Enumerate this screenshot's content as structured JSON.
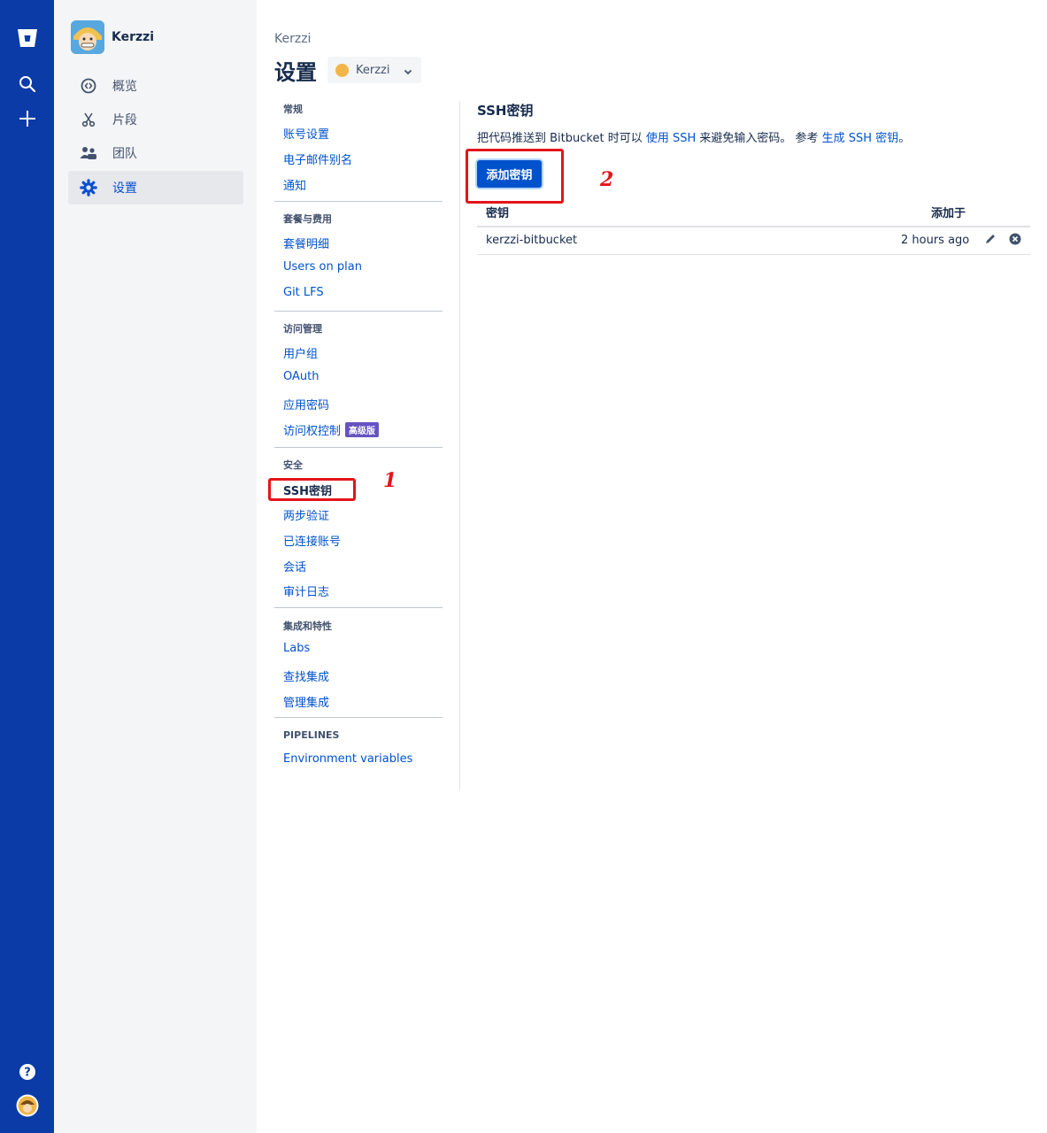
{
  "user": {
    "name": "Kerzzi"
  },
  "sidebar": {
    "items": [
      {
        "label": "概览"
      },
      {
        "label": "片段"
      },
      {
        "label": "团队"
      },
      {
        "label": "设置"
      }
    ]
  },
  "header": {
    "breadcrumb": "Kerzzi",
    "title": "设置",
    "workspace": "Kerzzi"
  },
  "settings_nav": {
    "groups": [
      {
        "heading": "常规",
        "links": [
          "账号设置",
          "电子邮件别名",
          "通知"
        ]
      },
      {
        "heading": "套餐与费用",
        "links": [
          "套餐明细",
          "Users on plan",
          "Git LFS"
        ]
      },
      {
        "heading": "访问管理",
        "links": [
          "用户组",
          "OAuth",
          "应用密码",
          "访问权控制"
        ],
        "badge": "高级版"
      },
      {
        "heading": "安全",
        "links": [
          "SSH密钥",
          "两步验证",
          "已连接账号",
          "会话",
          "审计日志"
        ]
      },
      {
        "heading": "集成和特性",
        "links": [
          "Labs",
          "查找集成",
          "管理集成"
        ]
      },
      {
        "heading": "PIPELINES",
        "links": [
          "Environment variables"
        ]
      }
    ]
  },
  "content": {
    "title": "SSH密钥",
    "desc_1": "把代码推送到 Bitbucket 时可以 ",
    "desc_link_1": "使用 SSH",
    "desc_2": " 来避免输入密码。 参考 ",
    "desc_link_2": "生成 SSH 密钥",
    "desc_3": "。",
    "add_button": "添加密钥",
    "table": {
      "headers": [
        "密钥",
        "添加于"
      ],
      "rows": [
        {
          "key": "kerzzi-bitbucket",
          "added": "2 hours ago"
        }
      ]
    }
  },
  "annotations": [
    "1",
    "2"
  ],
  "colors": {
    "rail": "#0b3ba6",
    "link": "#0052cc",
    "primary": "#0052cc",
    "annotation": "#e3151a",
    "badge": "#6554c0"
  },
  "icons": [
    "bitbucket-logo-icon",
    "search-icon",
    "plus-icon",
    "help-icon",
    "avatar",
    "overview-icon",
    "snippets-icon",
    "team-icon",
    "gear-icon",
    "chevron-down-icon",
    "pencil-icon",
    "remove-icon"
  ]
}
